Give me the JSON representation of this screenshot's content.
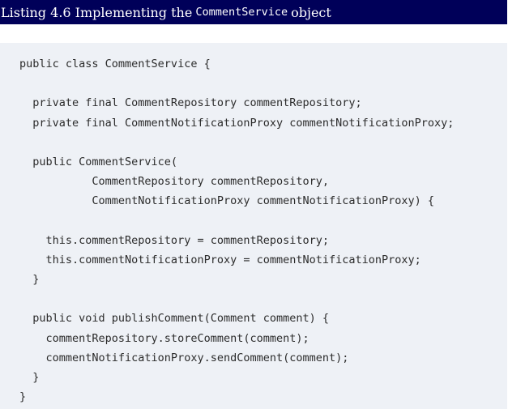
{
  "listing": {
    "prefix": "Listing 4.6 Implementing the",
    "class_name": "CommentService",
    "suffix": "object"
  },
  "code": {
    "lines": [
      "public class CommentService {",
      "",
      "  private final CommentRepository commentRepository;",
      "  private final CommentNotificationProxy commentNotificationProxy;",
      "",
      "  public CommentService(",
      "           CommentRepository commentRepository,",
      "           CommentNotificationProxy commentNotificationProxy) {",
      "",
      "    this.commentRepository = commentRepository;",
      "    this.commentNotificationProxy = commentNotificationProxy;",
      "  }",
      "",
      "  public void publishComment(Comment comment) {",
      "    commentRepository.storeComment(comment);",
      "    commentNotificationProxy.sendComment(comment);",
      "  }",
      "}"
    ]
  }
}
